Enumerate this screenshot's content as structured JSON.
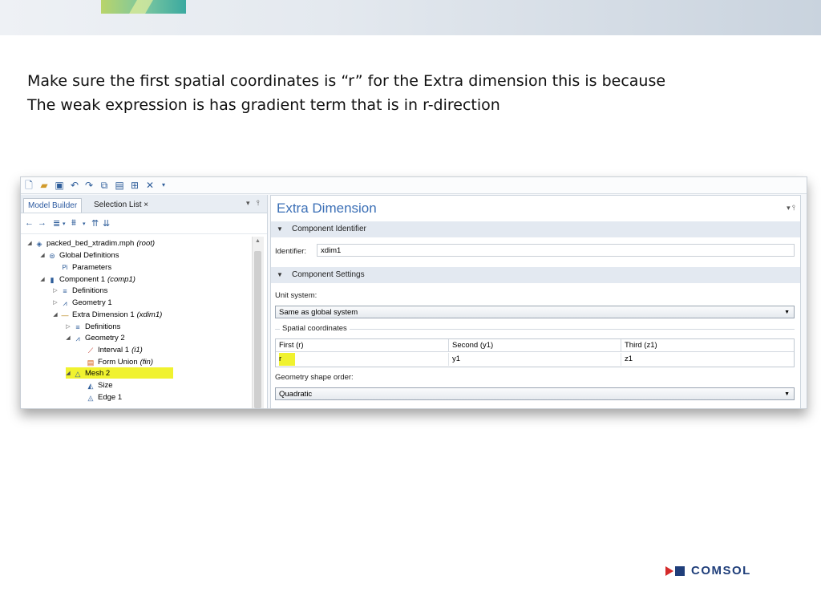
{
  "caption": {
    "line1": "Make sure the first spatial coordinates is “r” for the Extra dimension this is because",
    "line2": "The weak expression is has gradient term that is in r-direction"
  },
  "toolbar": {
    "icons": [
      "new-file-icon",
      "open-folder-icon",
      "save-icon",
      "undo-icon",
      "redo-icon",
      "copy-icon",
      "paste-icon",
      "duplicate-icon",
      "delete-icon",
      "dropdown-icon"
    ]
  },
  "left_panel": {
    "tabs": [
      {
        "label": "Model Builder",
        "active": true
      },
      {
        "label": "Selection List",
        "active": false
      }
    ],
    "close_glyph": "×",
    "tree": [
      {
        "label": "packed_bed_xtradim.mph",
        "tag": "(root)"
      },
      {
        "label": "Global Definitions",
        "tag": ""
      },
      {
        "label": "Parameters",
        "tag": ""
      },
      {
        "label": "Component 1",
        "tag": "(comp1)"
      },
      {
        "label": "Definitions",
        "tag": ""
      },
      {
        "label": "Geometry 1",
        "tag": ""
      },
      {
        "label": "Extra Dimension 1",
        "tag": "(xdim1)"
      },
      {
        "label": "Definitions",
        "tag": ""
      },
      {
        "label": "Geometry 2",
        "tag": ""
      },
      {
        "label": "Interval 1",
        "tag": "(i1)"
      },
      {
        "label": "Form Union",
        "tag": "(fin)"
      },
      {
        "label": "Mesh 2",
        "tag": ""
      },
      {
        "label": "Size",
        "tag": ""
      },
      {
        "label": "Edge 1",
        "tag": ""
      }
    ]
  },
  "right_panel": {
    "title": "Extra Dimension",
    "component_identifier": {
      "section_label": "Component Identifier",
      "identifier_label": "Identifier:",
      "identifier_value": "xdim1"
    },
    "component_settings": {
      "section_label": "Component Settings",
      "unit_system_label": "Unit system:",
      "unit_system_value": "Same as global system",
      "spatial_coordinates_label": "Spatial coordinates",
      "coordinates_headers": [
        "First (r)",
        "Second (y1)",
        "Third (z1)"
      ],
      "coordinates_values": [
        "r",
        "y1",
        "z1"
      ],
      "geometry_shape_order_label": "Geometry shape order:",
      "geometry_shape_order_value": "Quadratic"
    }
  },
  "highlight_color": "#f0f22f",
  "logo": {
    "text": "COMSOL",
    "colors": {
      "red": "#d42a2a",
      "navy": "#1f3e7a"
    }
  }
}
